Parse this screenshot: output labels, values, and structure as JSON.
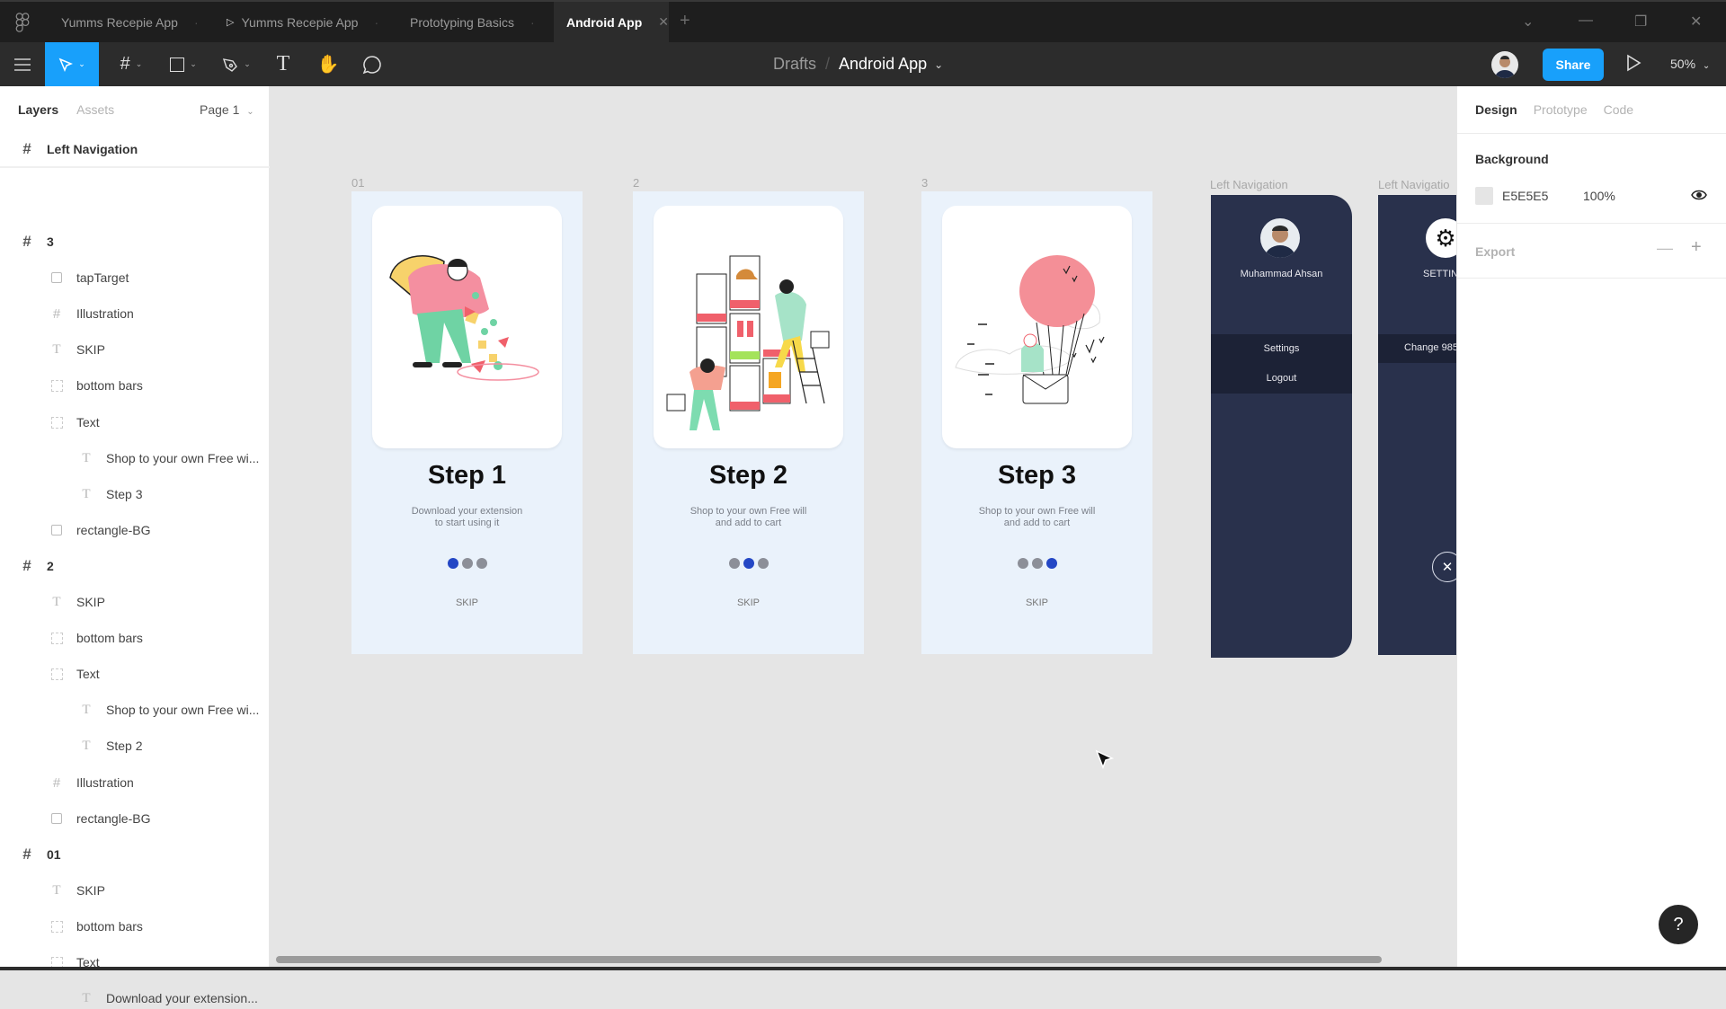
{
  "tabs": [
    {
      "label": "Yumms Recepie App",
      "prototype": false,
      "active": false
    },
    {
      "label": "Yumms Recepie App",
      "prototype": true,
      "active": false
    },
    {
      "label": "Prototyping Basics",
      "prototype": false,
      "active": false
    },
    {
      "label": "Android App",
      "prototype": false,
      "active": true
    }
  ],
  "toolbar": {
    "breadcrumb_parent": "Drafts",
    "breadcrumb_separator": "/",
    "file_name": "Android App",
    "share_label": "Share",
    "zoom_level": "50%",
    "tools": [
      "menu",
      "move",
      "frame",
      "shape",
      "pen",
      "text",
      "hand",
      "comment"
    ],
    "active_tool": "move",
    "accent_color": "#18A0FB"
  },
  "left_panel": {
    "tab_layers": "Layers",
    "tab_assets": "Assets",
    "page": "Page 1",
    "selected_frame": "Left Navigation",
    "layers": [
      {
        "name": "3",
        "type": "frame",
        "depth": 0
      },
      {
        "name": "tapTarget",
        "type": "rectangle",
        "depth": 1
      },
      {
        "name": "Illustration",
        "type": "frame",
        "depth": 1
      },
      {
        "name": "SKIP",
        "type": "text",
        "depth": 1
      },
      {
        "name": "bottom bars",
        "type": "group",
        "depth": 1
      },
      {
        "name": "Text",
        "type": "group",
        "depth": 1
      },
      {
        "name": "Shop to your own Free wi...",
        "type": "text",
        "depth": 2
      },
      {
        "name": "Step 3",
        "type": "text",
        "depth": 2
      },
      {
        "name": "rectangle-BG",
        "type": "rectangle",
        "depth": 1
      },
      {
        "name": "2",
        "type": "frame",
        "depth": 0
      },
      {
        "name": "SKIP",
        "type": "text",
        "depth": 1
      },
      {
        "name": "bottom bars",
        "type": "group",
        "depth": 1
      },
      {
        "name": "Text",
        "type": "group",
        "depth": 1
      },
      {
        "name": "Shop to your own Free wi...",
        "type": "text",
        "depth": 2
      },
      {
        "name": "Step 2",
        "type": "text",
        "depth": 2
      },
      {
        "name": "Illustration",
        "type": "frame",
        "depth": 1
      },
      {
        "name": "rectangle-BG",
        "type": "rectangle",
        "depth": 1
      },
      {
        "name": "01",
        "type": "frame",
        "depth": 0
      },
      {
        "name": "SKIP",
        "type": "text",
        "depth": 1
      },
      {
        "name": "bottom bars",
        "type": "group",
        "depth": 1
      },
      {
        "name": "Text",
        "type": "group",
        "depth": 1
      },
      {
        "name": "Download your extension...",
        "type": "text",
        "depth": 2
      }
    ]
  },
  "canvas": {
    "frames": [
      {
        "label": "01",
        "title": "Step 1",
        "desc_line1": "Download your extension",
        "desc_line2": "to start using it",
        "active_dot": 0,
        "skip": "SKIP",
        "illustration": "person-pouring-shapes"
      },
      {
        "label": "2",
        "title": "Step 2",
        "desc_line1": "Shop to your own Free will",
        "desc_line2": "and add to cart",
        "active_dot": 1,
        "skip": "SKIP",
        "illustration": "shopping-shelves"
      },
      {
        "label": "3",
        "title": "Step 3",
        "desc_line1": "Shop to your own Free will",
        "desc_line2": "and add to cart",
        "active_dot": 2,
        "skip": "SKIP",
        "illustration": "hot-air-balloon-envelope"
      }
    ],
    "nav1": {
      "label": "Left Navigation",
      "user_name": "Muhammad Ahsan",
      "menu": [
        "Settings",
        "Logout"
      ]
    },
    "nav2": {
      "label": "Left Navigatio",
      "heading": "SETTIN",
      "menu_item": "Change 985",
      "close_icon": "close-icon"
    },
    "phone_bg": "#EAF2FB",
    "nav_bg": "#29314C",
    "dot_active_color": "#2447C5"
  },
  "right_panel": {
    "tabs": [
      "Design",
      "Prototype",
      "Code"
    ],
    "active_tab": "Design",
    "background_label": "Background",
    "background_hex": "E5E5E5",
    "background_opacity": "100%",
    "export_label": "Export"
  },
  "help_label": "?"
}
